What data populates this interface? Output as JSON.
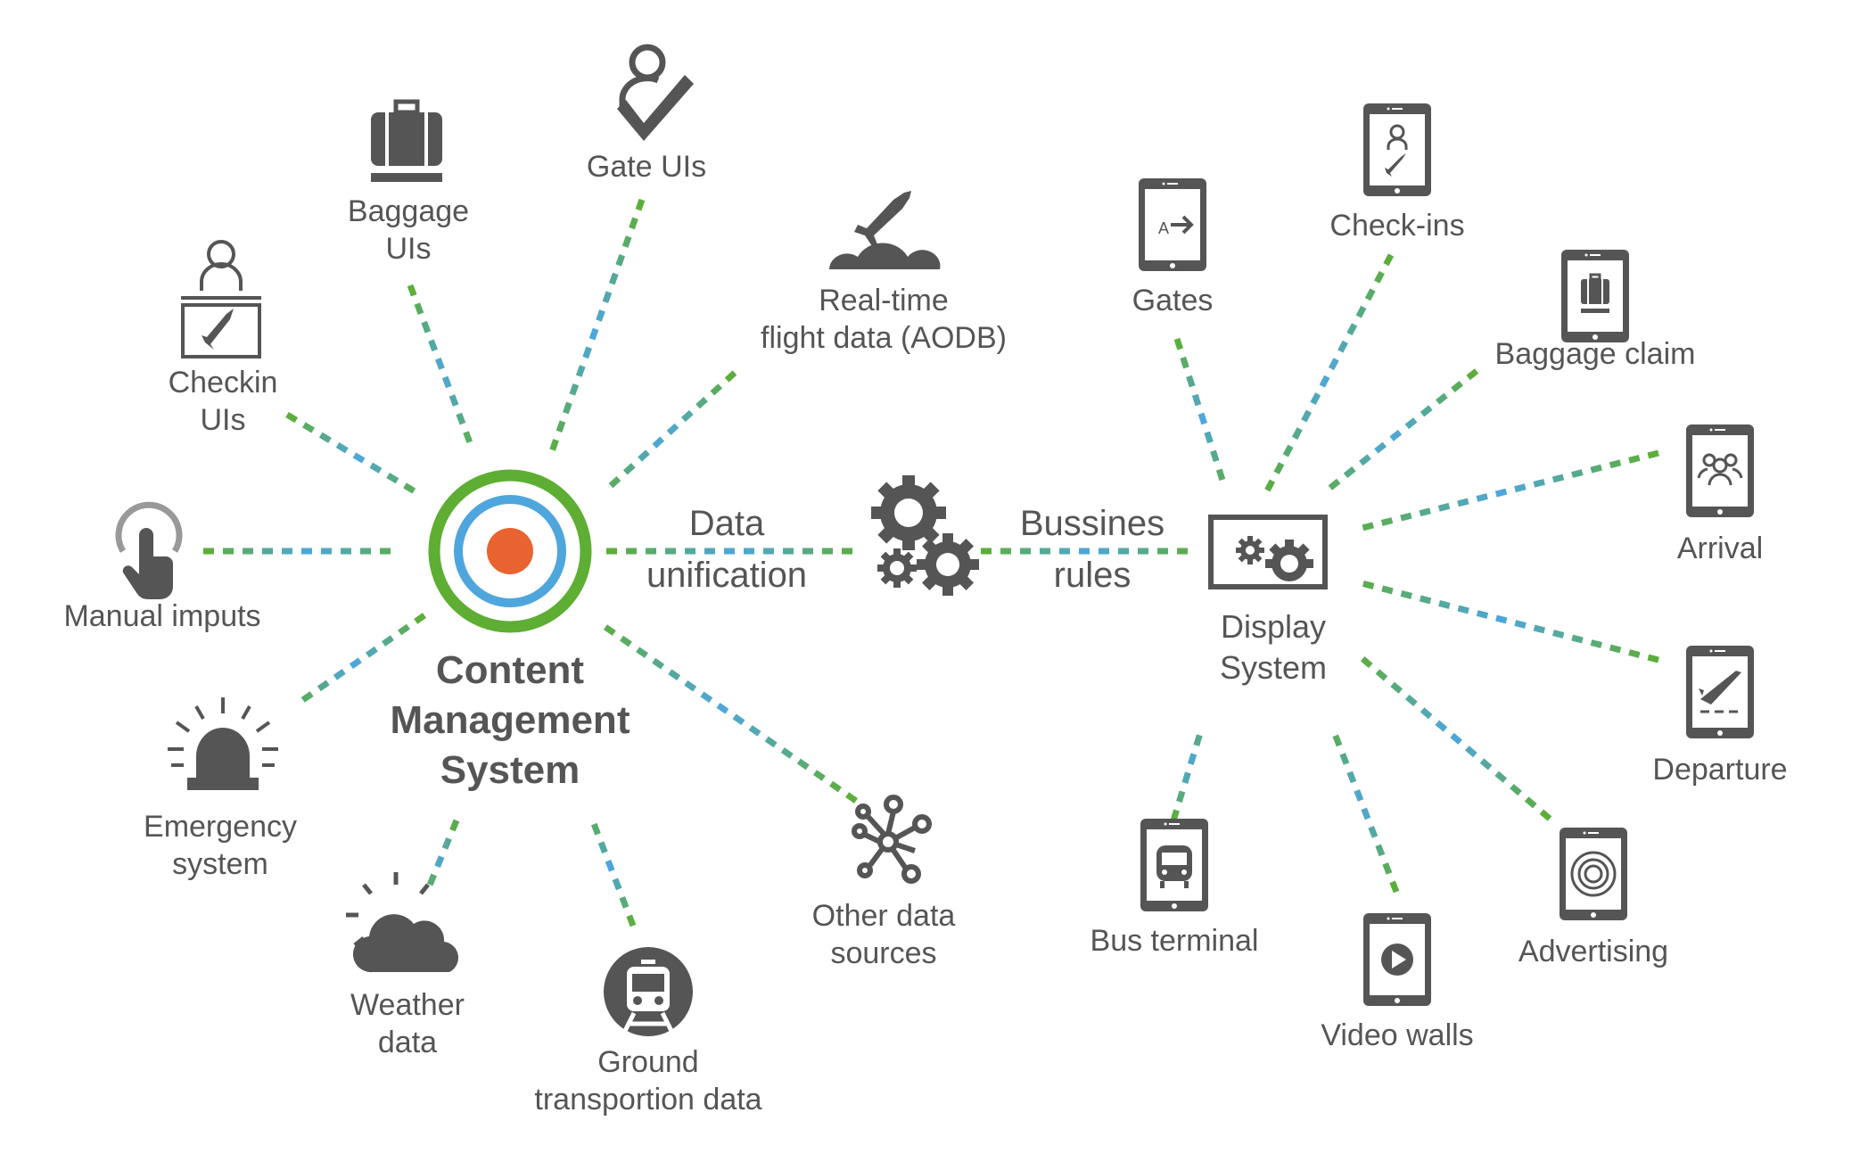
{
  "diagram": {
    "colors": {
      "text": "#555555",
      "icon": "#555555",
      "green": "#5DAE33",
      "blue": "#4EA6DC",
      "orange": "#E8632F",
      "teal": "#5BAA9B"
    },
    "hub": {
      "label": "Content\nManagement\nSystem",
      "icon": "target-icon"
    },
    "middle": {
      "left_label": "Data\nunification",
      "gears_icon": "gears-icon",
      "right_label": "Bussines\nrules"
    },
    "display": {
      "label": "Display\nSystem",
      "icon": "monitor-gears-icon"
    },
    "sources": [
      {
        "id": "manual",
        "label": "Manual imputs",
        "icon": "touch-hand-icon"
      },
      {
        "id": "checkin",
        "label": "Checkin\nUIs",
        "icon": "checkin-desk-icon"
      },
      {
        "id": "baggage",
        "label": "Baggage\nUIs",
        "icon": "suitcase-icon"
      },
      {
        "id": "gate",
        "label": "Gate UIs",
        "icon": "person-check-icon"
      },
      {
        "id": "flight",
        "label": "Real-time\nflight data (AODB)",
        "icon": "airplane-cloud-icon"
      },
      {
        "id": "other",
        "label": "Other data\nsources",
        "icon": "network-nodes-icon"
      },
      {
        "id": "ground",
        "label": "Ground\ntransportion data",
        "icon": "train-icon"
      },
      {
        "id": "weather",
        "label": "Weather\ndata",
        "icon": "sun-cloud-icon"
      },
      {
        "id": "emergency",
        "label": "Emergency\nsystem",
        "icon": "siren-icon"
      }
    ],
    "outputs": [
      {
        "id": "gates",
        "label": "Gates",
        "icon": "tablet-gate-arrow-icon"
      },
      {
        "id": "checkins",
        "label": "Check-ins",
        "icon": "tablet-person-plane-icon"
      },
      {
        "id": "bagclaim",
        "label": "Baggage claim",
        "icon": "tablet-suitcase-icon"
      },
      {
        "id": "arrival",
        "label": "Arrival",
        "icon": "tablet-people-icon"
      },
      {
        "id": "departure",
        "label": "Departure",
        "icon": "tablet-takeoff-icon"
      },
      {
        "id": "advertising",
        "label": "Advertising",
        "icon": "tablet-target-icon"
      },
      {
        "id": "video",
        "label": "Video walls",
        "icon": "tablet-play-icon"
      },
      {
        "id": "bus",
        "label": "Bus terminal",
        "icon": "tablet-bus-icon"
      }
    ]
  }
}
